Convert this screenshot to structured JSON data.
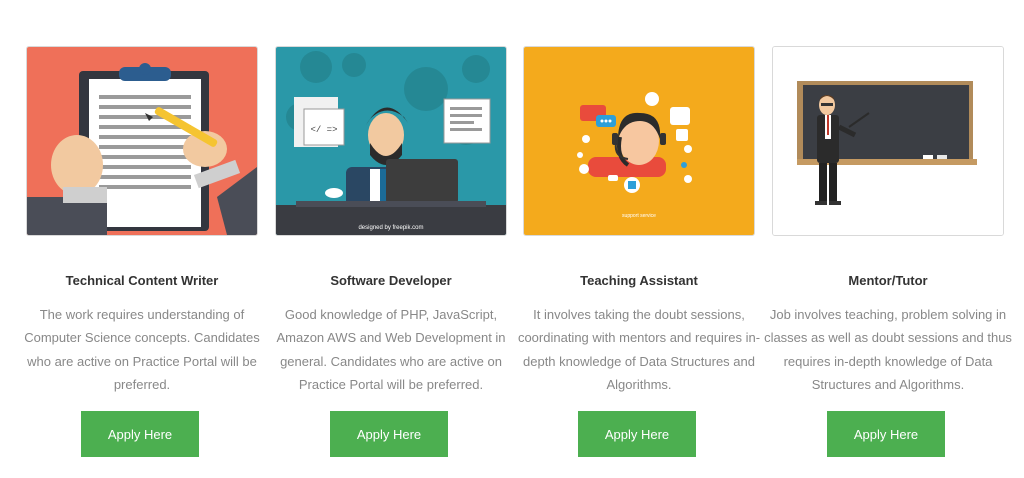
{
  "cards": [
    {
      "title": "Technical Content Writer",
      "description": "The work requires understanding of Computer Science concepts. Candidates who are active on Practice Portal will be preferred.",
      "button_label": "Apply Here",
      "image_bg": "#ef7059",
      "image_subject": "clipboard-writing-illustration"
    },
    {
      "title": "Software Developer",
      "description": "Good knowledge of PHP, JavaScript, Amazon AWS and Web Development in general. Candidates who are active on Practice Portal will be preferred.",
      "button_label": "Apply Here",
      "image_bg": "#2a98a8",
      "image_subject": "developer-at-desk-illustration",
      "image_credit": "designed by freepik.com"
    },
    {
      "title": "Teaching Assistant",
      "description": "It involves taking the doubt sessions, coordinating with mentors and requires in-depth knowledge of Data Structures and Algorithms.",
      "button_label": "Apply Here",
      "image_bg": "#f4aa1c",
      "image_subject": "support-assistant-illustration",
      "image_caption": "support service"
    },
    {
      "title": "Mentor/Tutor",
      "description": "Job involves teaching, problem solving in classes as well as doubt sessions and thus requires in-depth knowledge of Data Structures and Algorithms.",
      "button_label": "Apply Here",
      "image_bg": "#ffffff",
      "image_subject": "teacher-at-blackboard-illustration"
    }
  ],
  "colors": {
    "button": "#4caf50",
    "title": "#333333",
    "description": "#888888"
  }
}
